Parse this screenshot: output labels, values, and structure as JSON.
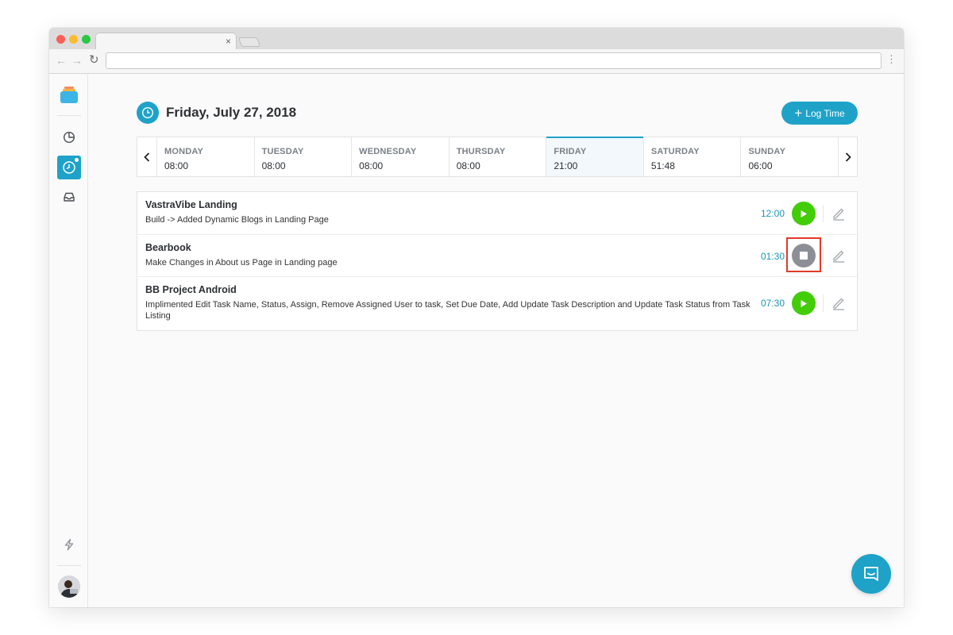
{
  "browser": {
    "tab_close_glyph": "×",
    "url": "",
    "icons": [
      "back-arrow-icon",
      "forward-arrow-icon",
      "reload-icon",
      "menu-dots-icon"
    ]
  },
  "sidebar": {
    "items": [
      {
        "name": "reports",
        "icon": "pie-chart-icon",
        "active": false
      },
      {
        "name": "time-tracker",
        "icon": "clock-icon",
        "active": true
      },
      {
        "name": "inbox",
        "icon": "inbox-icon",
        "active": false
      }
    ],
    "bottom_icon": "lightning-icon"
  },
  "header": {
    "date": "Friday, July 27, 2018",
    "log_time_label": "Log Time"
  },
  "week": {
    "days": [
      {
        "name": "MONDAY",
        "hours": "08:00",
        "active": false
      },
      {
        "name": "TUESDAY",
        "hours": "08:00",
        "active": false
      },
      {
        "name": "WEDNESDAY",
        "hours": "08:00",
        "active": false
      },
      {
        "name": "THURSDAY",
        "hours": "08:00",
        "active": false
      },
      {
        "name": "FRIDAY",
        "hours": "21:00",
        "active": true
      },
      {
        "name": "SATURDAY",
        "hours": "51:48",
        "active": false
      },
      {
        "name": "SUNDAY",
        "hours": "06:00",
        "active": false
      }
    ]
  },
  "tasks": [
    {
      "project": "VastraVibe Landing",
      "description": "Build -> Added Dynamic Blogs in Landing Page",
      "time": "12:00",
      "state": "play"
    },
    {
      "project": "Bearbook",
      "description": "Make Changes in About us Page in Landing page",
      "time": "01:30",
      "state": "stop"
    },
    {
      "project": "BB Project Android",
      "description": "Implimented Edit Task Name, Status, Assign, Remove Assigned User to task, Set Due Date, Add Update Task Description and Update Task Status from Task Listing",
      "time": "07:30",
      "state": "play"
    }
  ],
  "colors": {
    "accent": "#1ea2c8",
    "play": "#42cd08",
    "stop": "#8c9096",
    "highlight": "#e03a28"
  }
}
